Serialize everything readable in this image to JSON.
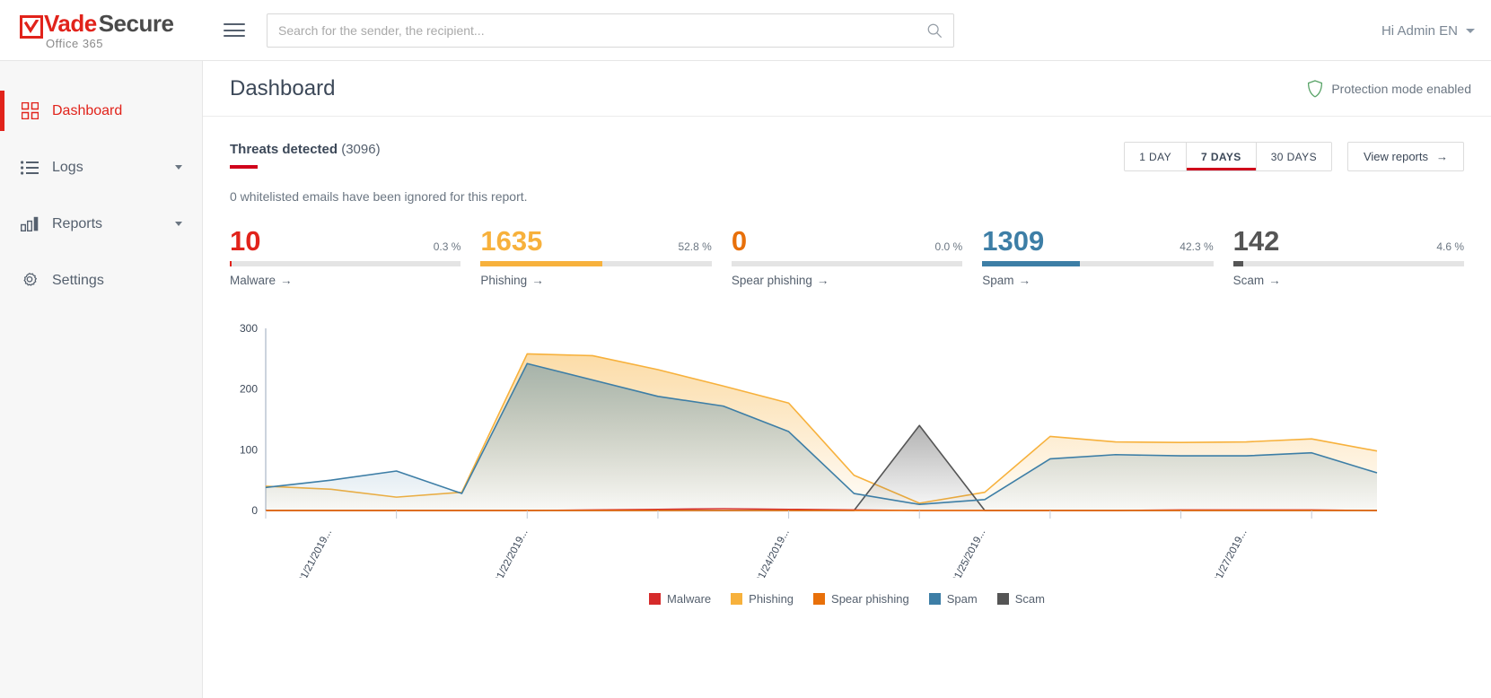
{
  "header": {
    "logo": {
      "vade": "Vade",
      "secure": "Secure",
      "sub": "Office 365",
      "icon": "checkmark-logo-icon"
    },
    "menu_icon": "hamburger-menu-icon",
    "search": {
      "placeholder": "Search for the sender, the recipient...",
      "value": "",
      "icon": "search-icon"
    },
    "user": {
      "label": "Hi Admin EN",
      "caret": "chevron-down-icon"
    }
  },
  "sidebar": {
    "items": [
      {
        "label": "Dashboard",
        "icon": "grid-icon",
        "active": true,
        "has_caret": false
      },
      {
        "label": "Logs",
        "icon": "list-icon",
        "active": false,
        "has_caret": true
      },
      {
        "label": "Reports",
        "icon": "bar-chart-icon",
        "active": false,
        "has_caret": true
      },
      {
        "label": "Settings",
        "icon": "gear-icon",
        "active": false,
        "has_caret": false
      }
    ]
  },
  "page": {
    "title": "Dashboard",
    "protection": {
      "label": "Protection mode enabled",
      "icon": "shield-icon",
      "color": "#5aa469"
    }
  },
  "report": {
    "title_bold": "Threats detected",
    "title_count": "(3096)",
    "note": "0 whitelisted emails have been ignored for this report.",
    "ranges": [
      {
        "label": "1 DAY",
        "active": false
      },
      {
        "label": "7 DAYS",
        "active": true
      },
      {
        "label": "30 DAYS",
        "active": false
      }
    ],
    "view_reports": {
      "label": "View reports",
      "arrow": "→"
    },
    "accent_color": "#d0021b"
  },
  "metrics": [
    {
      "value": "10",
      "pct": "0.3 %",
      "pct_num": 0.3,
      "label": "Malware",
      "arrow": "→",
      "color": "#e1231b"
    },
    {
      "value": "1635",
      "pct": "52.8 %",
      "pct_num": 52.8,
      "label": "Phishing",
      "arrow": "→",
      "color": "#f7b13c"
    },
    {
      "value": "0",
      "pct": "0.0 %",
      "pct_num": 0.0,
      "label": "Spear phishing",
      "arrow": "→",
      "color": "#e8700a"
    },
    {
      "value": "1309",
      "pct": "42.3 %",
      "pct_num": 42.3,
      "label": "Spam",
      "arrow": "→",
      "color": "#3d7ea6"
    },
    {
      "value": "142",
      "pct": "4.6 %",
      "pct_num": 4.6,
      "label": "Scam",
      "arrow": "→",
      "color": "#555555"
    }
  ],
  "chart_data": {
    "type": "area",
    "title": "Threats detected",
    "xlabel": "",
    "ylabel": "",
    "ylim": [
      0,
      300
    ],
    "yticks": [
      0,
      100,
      200,
      300
    ],
    "grid": false,
    "legend_position": "bottom",
    "x_tick_labels": [
      "01/21/2019...",
      "01/22/2019...",
      "01/24/2019...",
      "01/25/2019...",
      "01/27/2019..."
    ],
    "x_tick_indices": [
      1,
      4,
      8,
      11,
      15
    ],
    "x": [
      "01/20/2019",
      "01/21/2019",
      "01/21/2019",
      "01/22/2019",
      "01/22/2019",
      "01/23/2019",
      "01/23/2019",
      "01/24/2019",
      "01/24/2019",
      "01/24/2019",
      "01/25/2019",
      "01/25/2019",
      "01/26/2019",
      "01/26/2019",
      "01/27/2019",
      "01/27/2019",
      "01/28/2019",
      "01/28/2019"
    ],
    "series": [
      {
        "name": "Malware",
        "color": "#d62b2b",
        "values": [
          0,
          0,
          0,
          0,
          0,
          1,
          2,
          3,
          2,
          1,
          0,
          0,
          0,
          0,
          1,
          1,
          1,
          0
        ]
      },
      {
        "name": "Phishing",
        "color": "#f7b13c",
        "values": [
          40,
          35,
          22,
          30,
          258,
          255,
          232,
          205,
          177,
          58,
          12,
          30,
          122,
          113,
          112,
          113,
          118,
          98
        ]
      },
      {
        "name": "Spear phishing",
        "color": "#e8700a",
        "values": [
          0,
          0,
          0,
          0,
          0,
          0,
          0,
          0,
          0,
          0,
          0,
          0,
          0,
          0,
          0,
          0,
          0,
          0
        ]
      },
      {
        "name": "Spam",
        "color": "#3d7ea6",
        "values": [
          38,
          50,
          65,
          28,
          242,
          215,
          188,
          172,
          130,
          28,
          10,
          18,
          85,
          92,
          90,
          90,
          95,
          62
        ]
      },
      {
        "name": "Scam",
        "color": "#555555",
        "values": [
          0,
          0,
          0,
          0,
          0,
          0,
          0,
          0,
          0,
          0,
          140,
          0,
          0,
          0,
          0,
          0,
          0,
          0
        ]
      }
    ],
    "legend": [
      "Malware",
      "Phishing",
      "Spear phishing",
      "Spam",
      "Scam"
    ]
  }
}
